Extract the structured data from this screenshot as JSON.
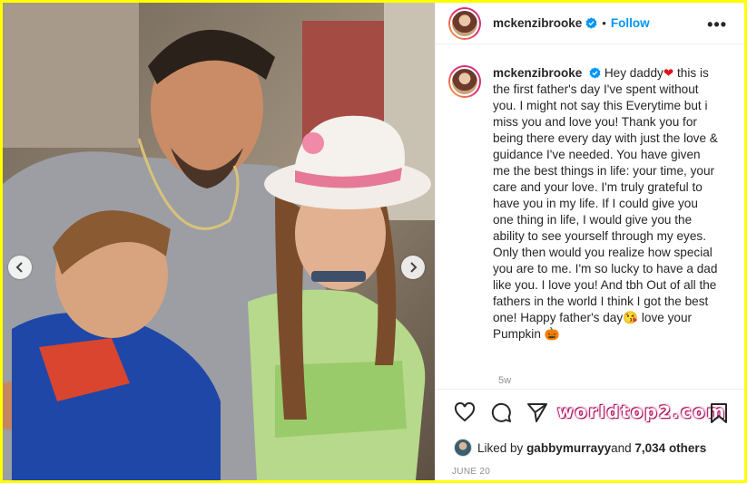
{
  "post": {
    "username": "mckenzibrooke",
    "follow_label": "Follow",
    "separator": "•",
    "more_label": "•••",
    "caption_lines": [
      "Hey daddy",
      " this is the first father's day I've spent without you. I might not say this Everytime but i miss you and love you! Thank you for being there every day with just the love & guidance I've needed. You have given me the best things in life: your time, your care and your love. I'm truly grateful to have you in my life. If I could give you one thing in life, I would give you the ability to see yourself through my eyes. Only then would you realize how special you are to me. I'm so lucky to have a dad like you. I love you! And tbh Out of all the fathers in the world I think I got the best one! Happy father's day",
      " love your Pumpkin "
    ],
    "heart_emoji": "❤",
    "kiss_emoji": "😘",
    "pumpkin_emoji": "🎃",
    "time_ago": "5w",
    "liked_by_prefix": "Liked by ",
    "liked_by_user": "gabbymurrayy",
    "liked_by_and": " and ",
    "liked_by_count": "7,034 others",
    "date": "JUNE 20"
  },
  "watermark": "worldtop2.com",
  "icons": {
    "verified": "verified-badge-icon",
    "like": "heart-outline-icon",
    "comment": "comment-icon",
    "share": "paper-plane-icon",
    "save": "bookmark-icon",
    "prev": "chevron-left-icon",
    "next": "chevron-right-icon"
  },
  "colors": {
    "border": "#ffff00",
    "link": "#0095f6",
    "verified": "#0095f6",
    "text": "#262626",
    "muted": "#8e8e8e"
  }
}
